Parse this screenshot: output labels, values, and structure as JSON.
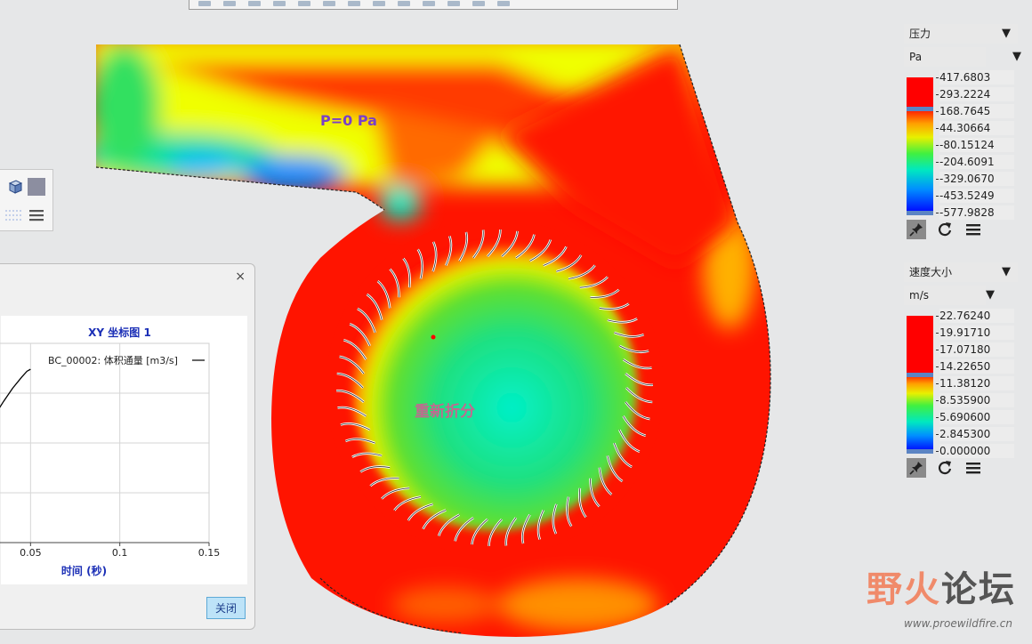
{
  "simulation": {
    "outlet_label": "P=0 Pa",
    "status_text": "重新折分"
  },
  "legend_pressure": {
    "quantity": "压力",
    "unit": "Pa",
    "ticks": [
      "417.6803",
      "293.2224",
      "168.7645",
      "44.30664",
      "-80.15124",
      "-204.6091",
      "-329.0670",
      "-453.5249",
      "-577.9828"
    ]
  },
  "legend_velocity": {
    "quantity": "速度大小",
    "unit": "m/s",
    "ticks": [
      "22.76240",
      "19.91710",
      "17.07180",
      "14.22650",
      "11.38120",
      "8.535900",
      "5.690600",
      "2.845300",
      "0.000000"
    ]
  },
  "dialog": {
    "close_glyph": "×",
    "close_button_label": "关闭"
  },
  "chart_data": {
    "type": "line",
    "title": "XY 坐标图 1",
    "xlabel": "时间 (秒)",
    "ylabel": "",
    "x_ticks": [
      "0.05",
      "0.1",
      "0.15"
    ],
    "xlim": [
      0.0,
      0.15
    ],
    "grid": true,
    "legend_placement": "top-right",
    "series": [
      {
        "name": "BC_00002: 体积通量 [m3/s]",
        "x": [
          0.0,
          0.005,
          0.01,
          0.015,
          0.02,
          0.025,
          0.03,
          0.035,
          0.04,
          0.045,
          0.048,
          0.05
        ],
        "y": [
          0.3,
          0.345,
          0.395,
          0.45,
          0.51,
          0.575,
          0.64,
          0.71,
          0.775,
          0.83,
          0.86,
          0.87
        ],
        "color": "#000000"
      }
    ]
  },
  "watermark": {
    "text_a": "野火",
    "text_b": "论坛",
    "url": "www.proewildfire.cn"
  },
  "colors": {
    "accent_blue": "#1b2fb6",
    "close_button_bg": "#bde3f8"
  }
}
